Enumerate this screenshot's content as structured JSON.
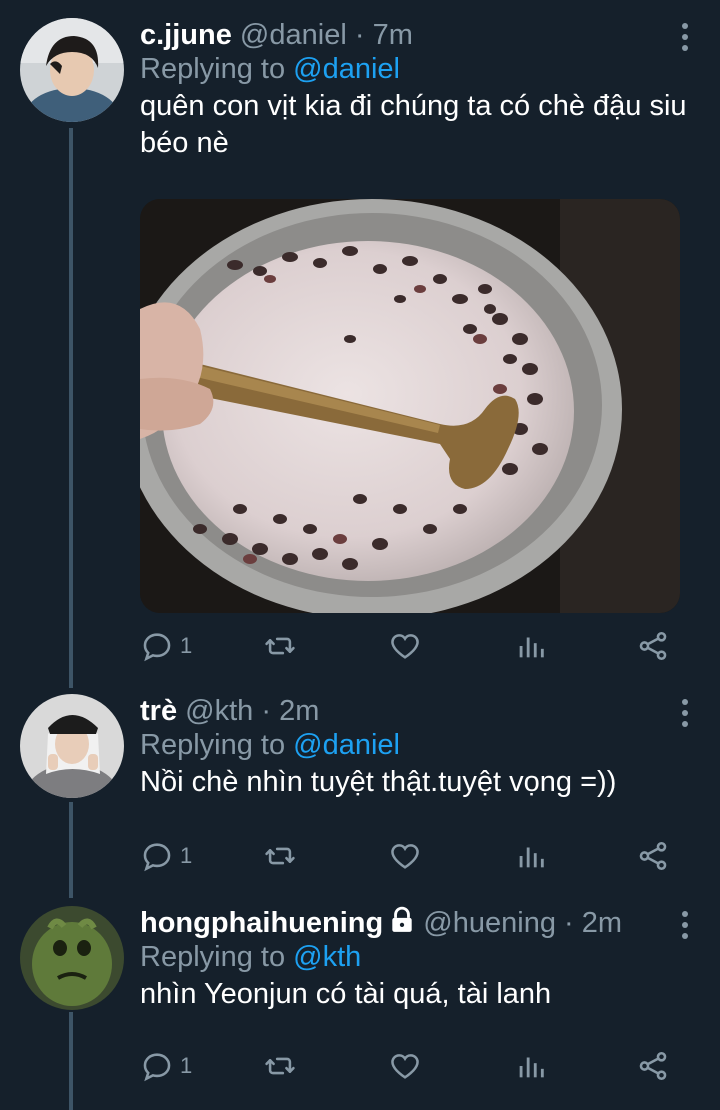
{
  "tweets": [
    {
      "name": "c.jjune",
      "handle": "@daniel",
      "dot": "·",
      "time": "7m",
      "replying_label": "Replying to",
      "replying_to": "@daniel",
      "text": "quên con vịt kia đi chúng ta có chè đậu siu béo nè",
      "reply_count": "1",
      "has_media": true
    },
    {
      "name": "trè",
      "handle": "@kth",
      "dot": "·",
      "time": "2m",
      "replying_label": "Replying to",
      "replying_to": "@daniel",
      "text": "Nồi chè nhìn tuyệt thật.tuyệt vọng =))",
      "reply_count": "1"
    },
    {
      "name": "hongphaihuening",
      "handle": "@huening",
      "dot": "·",
      "time": "2m",
      "replying_label": "Replying to",
      "replying_to": "@kth",
      "text": "nhìn Yeonjun có tài quá, tài lanh",
      "reply_count": "1",
      "protected": true
    }
  ],
  "icons": {
    "reply": "reply-icon",
    "retweet": "retweet-icon",
    "like": "heart-icon",
    "analytics": "analytics-icon",
    "share": "share-icon",
    "more": "more-vertical-icon",
    "lock": "lock-icon"
  },
  "colors": {
    "background": "#15202b",
    "muted": "#8899a6",
    "link": "#1da1f2",
    "thread_line": "#3d5466"
  }
}
